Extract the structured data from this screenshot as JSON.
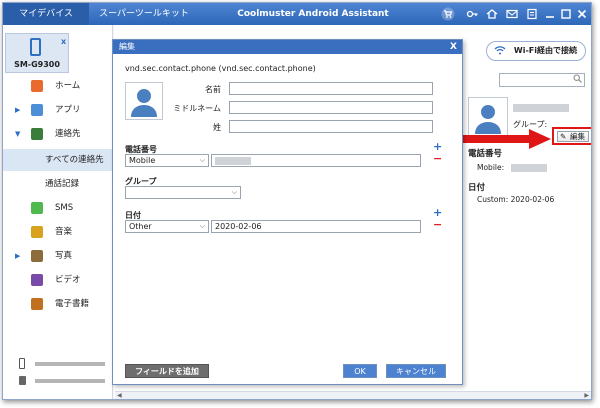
{
  "titlebar": {
    "tab_device": "マイデバイス",
    "tab_toolkit": "スーパーツールキット",
    "app_title": "Coolmuster Android Assistant",
    "icons": [
      "cart-icon",
      "key-icon",
      "home-icon",
      "mail-icon",
      "menu-icon",
      "minimize-icon",
      "maximize-icon",
      "close-icon"
    ]
  },
  "device": {
    "name": "SM-G9300",
    "close": "x"
  },
  "sidebar": {
    "items": [
      {
        "label": "ホーム",
        "icon": "home-icon",
        "color": "#e86a2e"
      },
      {
        "label": "アプリ",
        "icon": "apps-icon",
        "color": "#4d8fd6",
        "expand": "▶"
      },
      {
        "label": "連絡先",
        "icon": "contacts-icon",
        "color": "#3a7d3a",
        "expand": "▼"
      },
      {
        "label": "すべての連絡先"
      },
      {
        "label": "通話記録"
      },
      {
        "label": "SMS",
        "icon": "sms-icon",
        "color": "#4fb84f"
      },
      {
        "label": "音楽",
        "icon": "music-icon",
        "color": "#d9a21e"
      },
      {
        "label": "写真",
        "icon": "photo-icon",
        "color": "#8a6d3b",
        "expand": "▶"
      },
      {
        "label": "ビデオ",
        "icon": "video-icon",
        "color": "#7a4aa8"
      },
      {
        "label": "電子書籍",
        "icon": "ebook-icon",
        "color": "#c0701e"
      }
    ]
  },
  "dialog": {
    "title": "編集",
    "close": "X",
    "contact_type": "vnd.sec.contact.phone (vnd.sec.contact.phone)",
    "labels": {
      "first_name": "名前",
      "middle_name": "ミドルネーム",
      "last_name": "姓"
    },
    "phone_section": "電話番号",
    "phone_type": "Mobile",
    "group_section": "グループ",
    "date_section": "日付",
    "date_type": "Other",
    "date_value": "2020-02-06",
    "add_field": "フィールドを追加",
    "ok": "OK",
    "cancel": "キャンセル",
    "plus": "+",
    "minus": "−"
  },
  "right_panel": {
    "wifi": "Wi-Fi経由で接続",
    "group_label": "グループ:",
    "edit_button": "編集",
    "phone_heading": "電話番号",
    "mobile_label": "Mobile:",
    "date_heading": "日付",
    "custom_date": "Custom: 2020-02-06"
  },
  "colors": {
    "titlebar": "#3a72c4",
    "accent": "#2f6fc2",
    "highlight": "#e01616"
  }
}
